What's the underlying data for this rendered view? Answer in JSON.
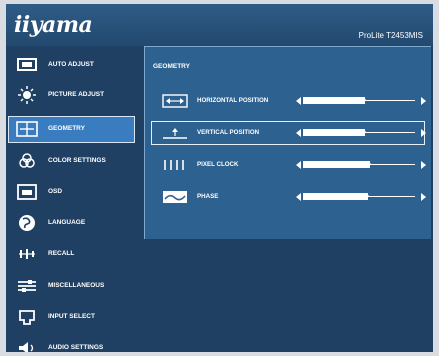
{
  "header": {
    "brand": "iiyama",
    "model": "ProLite T2453MIS"
  },
  "sidebar": {
    "items": [
      {
        "label": "AUTO ADJUST",
        "icon": "auto-adjust-icon"
      },
      {
        "label": "PICTURE ADJUST",
        "icon": "brightness-icon"
      },
      {
        "label": "GEOMETRY",
        "icon": "geometry-icon",
        "selected": true
      },
      {
        "label": "COLOR SETTINGS",
        "icon": "color-settings-icon"
      },
      {
        "label": "OSD",
        "icon": "osd-icon"
      },
      {
        "label": "LANGUAGE",
        "icon": "globe-icon"
      },
      {
        "label": "RECALL",
        "icon": "recall-icon"
      },
      {
        "label": "MISCELLANEOUS",
        "icon": "miscellaneous-icon"
      },
      {
        "label": "INPUT SELECT",
        "icon": "input-select-icon"
      },
      {
        "label": "AUDIO SETTINGS",
        "icon": "audio-icon"
      }
    ]
  },
  "panel": {
    "title": "GEOMETRY",
    "items": [
      {
        "label": "HORIZONTAL POSITION",
        "icon": "horizontal-position-icon",
        "level": 0.55
      },
      {
        "label": "VERTICAL POSITION",
        "icon": "vertical-position-icon",
        "level": 0.55,
        "selected": true
      },
      {
        "label": "PIXEL CLOCK",
        "icon": "pixel-clock-icon",
        "level": 0.6
      },
      {
        "label": "PHASE",
        "icon": "phase-icon",
        "level": 0.58
      }
    ]
  },
  "colors": {
    "background": "#1f4063",
    "panel": "#2d6190",
    "selected": "#3a7cc0",
    "text": "#ffffff"
  }
}
